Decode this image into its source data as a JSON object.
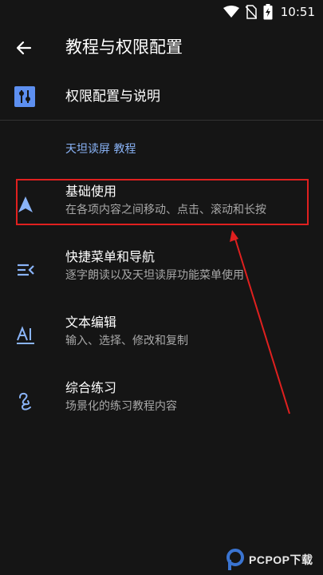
{
  "status_bar": {
    "time": "10:51"
  },
  "app_bar": {
    "title": "教程与权限配置"
  },
  "permissions_row": {
    "label": "权限配置与说明"
  },
  "section": {
    "header": "天坦读屏 教程"
  },
  "items": [
    {
      "title": "基础使用",
      "subtitle": "在各项内容之间移动、点击、滚动和长按",
      "icon": "navigation-arrow-icon"
    },
    {
      "title": "快捷菜单和导航",
      "subtitle": "逐字朗读以及天坦读屏功能菜单使用",
      "icon": "menu-lines-icon"
    },
    {
      "title": "文本编辑",
      "subtitle": "输入、选择、修改和复制",
      "icon": "text-ai-icon"
    },
    {
      "title": "综合练习",
      "subtitle": "场景化的练习教程内容",
      "icon": "gesture-squiggle-icon"
    }
  ],
  "watermark": {
    "text": "PCPOP下载"
  },
  "colors": {
    "accent": "#8ab4f8",
    "icon_blue": "#5d8ff0",
    "annotation_red": "#e0201f",
    "background": "#151515"
  }
}
